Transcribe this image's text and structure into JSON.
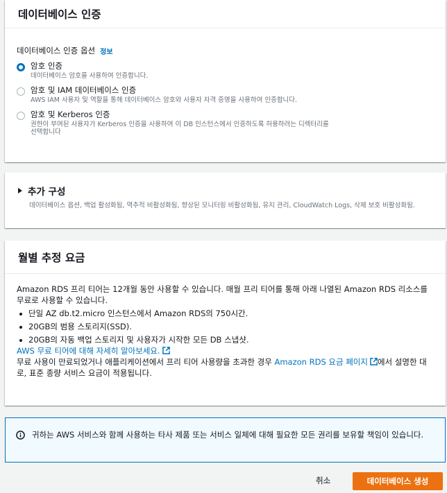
{
  "auth": {
    "title": "데이터베이스 인증",
    "options_label": "데이터베이스 인증 옵션",
    "info_link": "정보",
    "options": [
      {
        "label": "암호 인증",
        "desc": "데이터베이스 암호를 사용하여 인증합니다.",
        "selected": true
      },
      {
        "label": "암호 및 IAM 데이터베이스 인증",
        "desc": "AWS IAM 사용자 및 역할을 통해 데이터베이스 암호와 사용자 자격 증명을 사용하여 인증합니다.",
        "selected": false
      },
      {
        "label": "암호 및 Kerberos 인증",
        "desc": "권한이 부여된 사용자가 Kerberos 인증을 사용하여 이 DB 인스턴스에서 인증하도록 허용하려는 디렉터리를 선택합니다",
        "selected": false
      }
    ]
  },
  "extra": {
    "title": "추가 구성",
    "desc": "데이터베이스 옵션, 백업 활성화됨, 역추적 비활성화됨, 향상된 모니터링 비활성화됨, 유지 관리, CloudWatch Logs, 삭제 보호 비활성화됨."
  },
  "pricing": {
    "title": "월별 추정 요금",
    "intro": "Amazon RDS 프리 티어는 12개월 동안 사용할 수 있습니다. 매월 프리 티어를 통해 아래 나열된 Amazon RDS 리소스를 무료로 사용할 수 있습니다.",
    "items": [
      "단일 AZ db.t2.micro 인스턴스에서 Amazon RDS의 750시간.",
      "20GB의 범용 스토리지(SSD).",
      "20GB의 자동 백업 스토리지 및 사용자가 시작한 모든 DB 스냅샷."
    ],
    "learn_link": "AWS 무료 티어에 대해 자세히 알아보세요.",
    "charge_before": "무료 사용이 만료되었거나 애플리케이션에서 프리 티어 사용량을 초과한 경우 ",
    "charge_link": "Amazon RDS 요금 페이지",
    "charge_after": "에서 설명한 대로, 표준 종량 서비스 요금이 적용됩니다."
  },
  "notice": {
    "text": "귀하는 AWS 서비스와 함께 사용하는 타사 제품 또는 서비스 일체에 대해 필요한 모든 권리를 보유할 책임이 있습니다."
  },
  "footer": {
    "cancel_label": "취소",
    "create_label": "데이터베이스 생성"
  },
  "colors": {
    "primary_button": "#ec7211",
    "link": "#0073bb",
    "notice_bg": "#f1faff"
  }
}
